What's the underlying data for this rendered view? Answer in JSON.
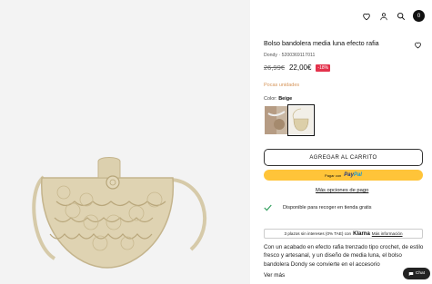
{
  "header": {
    "icons": [
      "heart-icon",
      "user-icon",
      "search-icon",
      "cart-icon"
    ],
    "cart_count": "0"
  },
  "product": {
    "title": "Bolso bandolera media luna efecto rafia",
    "sku": "Dondy · 5200369117011",
    "old_price": "26,99€",
    "new_price": "22,00€",
    "discount": "-18%",
    "stock_notice": "Pocas unidades",
    "color_label": "Color:",
    "color_value": "Beige",
    "swatch_count": 2,
    "selected_swatch": 2
  },
  "actions": {
    "add_to_cart": "AGREGAR AL CARRITO",
    "paypal_prefix": "Pagar con",
    "paypal_brand_a": "Pay",
    "paypal_brand_b": "Pal",
    "more_payment": "Más opciones de pago"
  },
  "pickup": {
    "text": "Disponible para recoger en tienda gratis"
  },
  "klarna": {
    "text": "3 plazos sin intereses (0% TAE) con",
    "brand": "Klarna",
    "link": "Más información"
  },
  "description": {
    "text": "Con un acabado en efecto rafia trenzado tipo crochet, de estilo fresco y artesanal, y un diseño de media luna, el bolso bandolera Dondy se convierte en el accesorio",
    "more": "Ver más"
  },
  "chat": {
    "label": "Chat"
  },
  "colors": {
    "accent": "#111111",
    "discount": "#e3324c",
    "stock": "#d6955a",
    "paypal": "#ffc439",
    "check": "#2e9e5b"
  }
}
